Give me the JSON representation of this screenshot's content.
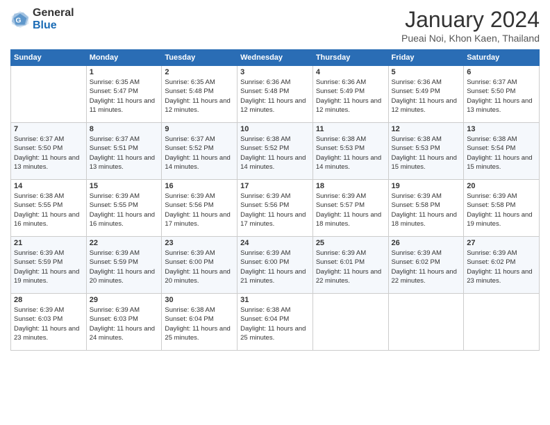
{
  "logo": {
    "general": "General",
    "blue": "Blue"
  },
  "header": {
    "month": "January 2024",
    "location": "Pueai Noi, Khon Kaen, Thailand"
  },
  "weekdays": [
    "Sunday",
    "Monday",
    "Tuesday",
    "Wednesday",
    "Thursday",
    "Friday",
    "Saturday"
  ],
  "weeks": [
    [
      {
        "day": "",
        "sunrise": "",
        "sunset": "",
        "daylight": ""
      },
      {
        "day": "1",
        "sunrise": "Sunrise: 6:35 AM",
        "sunset": "Sunset: 5:47 PM",
        "daylight": "Daylight: 11 hours and 11 minutes."
      },
      {
        "day": "2",
        "sunrise": "Sunrise: 6:35 AM",
        "sunset": "Sunset: 5:48 PM",
        "daylight": "Daylight: 11 hours and 12 minutes."
      },
      {
        "day": "3",
        "sunrise": "Sunrise: 6:36 AM",
        "sunset": "Sunset: 5:48 PM",
        "daylight": "Daylight: 11 hours and 12 minutes."
      },
      {
        "day": "4",
        "sunrise": "Sunrise: 6:36 AM",
        "sunset": "Sunset: 5:49 PM",
        "daylight": "Daylight: 11 hours and 12 minutes."
      },
      {
        "day": "5",
        "sunrise": "Sunrise: 6:36 AM",
        "sunset": "Sunset: 5:49 PM",
        "daylight": "Daylight: 11 hours and 12 minutes."
      },
      {
        "day": "6",
        "sunrise": "Sunrise: 6:37 AM",
        "sunset": "Sunset: 5:50 PM",
        "daylight": "Daylight: 11 hours and 13 minutes."
      }
    ],
    [
      {
        "day": "7",
        "sunrise": "Sunrise: 6:37 AM",
        "sunset": "Sunset: 5:50 PM",
        "daylight": "Daylight: 11 hours and 13 minutes."
      },
      {
        "day": "8",
        "sunrise": "Sunrise: 6:37 AM",
        "sunset": "Sunset: 5:51 PM",
        "daylight": "Daylight: 11 hours and 13 minutes."
      },
      {
        "day": "9",
        "sunrise": "Sunrise: 6:37 AM",
        "sunset": "Sunset: 5:52 PM",
        "daylight": "Daylight: 11 hours and 14 minutes."
      },
      {
        "day": "10",
        "sunrise": "Sunrise: 6:38 AM",
        "sunset": "Sunset: 5:52 PM",
        "daylight": "Daylight: 11 hours and 14 minutes."
      },
      {
        "day": "11",
        "sunrise": "Sunrise: 6:38 AM",
        "sunset": "Sunset: 5:53 PM",
        "daylight": "Daylight: 11 hours and 14 minutes."
      },
      {
        "day": "12",
        "sunrise": "Sunrise: 6:38 AM",
        "sunset": "Sunset: 5:53 PM",
        "daylight": "Daylight: 11 hours and 15 minutes."
      },
      {
        "day": "13",
        "sunrise": "Sunrise: 6:38 AM",
        "sunset": "Sunset: 5:54 PM",
        "daylight": "Daylight: 11 hours and 15 minutes."
      }
    ],
    [
      {
        "day": "14",
        "sunrise": "Sunrise: 6:38 AM",
        "sunset": "Sunset: 5:55 PM",
        "daylight": "Daylight: 11 hours and 16 minutes."
      },
      {
        "day": "15",
        "sunrise": "Sunrise: 6:39 AM",
        "sunset": "Sunset: 5:55 PM",
        "daylight": "Daylight: 11 hours and 16 minutes."
      },
      {
        "day": "16",
        "sunrise": "Sunrise: 6:39 AM",
        "sunset": "Sunset: 5:56 PM",
        "daylight": "Daylight: 11 hours and 17 minutes."
      },
      {
        "day": "17",
        "sunrise": "Sunrise: 6:39 AM",
        "sunset": "Sunset: 5:56 PM",
        "daylight": "Daylight: 11 hours and 17 minutes."
      },
      {
        "day": "18",
        "sunrise": "Sunrise: 6:39 AM",
        "sunset": "Sunset: 5:57 PM",
        "daylight": "Daylight: 11 hours and 18 minutes."
      },
      {
        "day": "19",
        "sunrise": "Sunrise: 6:39 AM",
        "sunset": "Sunset: 5:58 PM",
        "daylight": "Daylight: 11 hours and 18 minutes."
      },
      {
        "day": "20",
        "sunrise": "Sunrise: 6:39 AM",
        "sunset": "Sunset: 5:58 PM",
        "daylight": "Daylight: 11 hours and 19 minutes."
      }
    ],
    [
      {
        "day": "21",
        "sunrise": "Sunrise: 6:39 AM",
        "sunset": "Sunset: 5:59 PM",
        "daylight": "Daylight: 11 hours and 19 minutes."
      },
      {
        "day": "22",
        "sunrise": "Sunrise: 6:39 AM",
        "sunset": "Sunset: 5:59 PM",
        "daylight": "Daylight: 11 hours and 20 minutes."
      },
      {
        "day": "23",
        "sunrise": "Sunrise: 6:39 AM",
        "sunset": "Sunset: 6:00 PM",
        "daylight": "Daylight: 11 hours and 20 minutes."
      },
      {
        "day": "24",
        "sunrise": "Sunrise: 6:39 AM",
        "sunset": "Sunset: 6:00 PM",
        "daylight": "Daylight: 11 hours and 21 minutes."
      },
      {
        "day": "25",
        "sunrise": "Sunrise: 6:39 AM",
        "sunset": "Sunset: 6:01 PM",
        "daylight": "Daylight: 11 hours and 22 minutes."
      },
      {
        "day": "26",
        "sunrise": "Sunrise: 6:39 AM",
        "sunset": "Sunset: 6:02 PM",
        "daylight": "Daylight: 11 hours and 22 minutes."
      },
      {
        "day": "27",
        "sunrise": "Sunrise: 6:39 AM",
        "sunset": "Sunset: 6:02 PM",
        "daylight": "Daylight: 11 hours and 23 minutes."
      }
    ],
    [
      {
        "day": "28",
        "sunrise": "Sunrise: 6:39 AM",
        "sunset": "Sunset: 6:03 PM",
        "daylight": "Daylight: 11 hours and 23 minutes."
      },
      {
        "day": "29",
        "sunrise": "Sunrise: 6:39 AM",
        "sunset": "Sunset: 6:03 PM",
        "daylight": "Daylight: 11 hours and 24 minutes."
      },
      {
        "day": "30",
        "sunrise": "Sunrise: 6:38 AM",
        "sunset": "Sunset: 6:04 PM",
        "daylight": "Daylight: 11 hours and 25 minutes."
      },
      {
        "day": "31",
        "sunrise": "Sunrise: 6:38 AM",
        "sunset": "Sunset: 6:04 PM",
        "daylight": "Daylight: 11 hours and 25 minutes."
      },
      {
        "day": "",
        "sunrise": "",
        "sunset": "",
        "daylight": ""
      },
      {
        "day": "",
        "sunrise": "",
        "sunset": "",
        "daylight": ""
      },
      {
        "day": "",
        "sunrise": "",
        "sunset": "",
        "daylight": ""
      }
    ]
  ]
}
